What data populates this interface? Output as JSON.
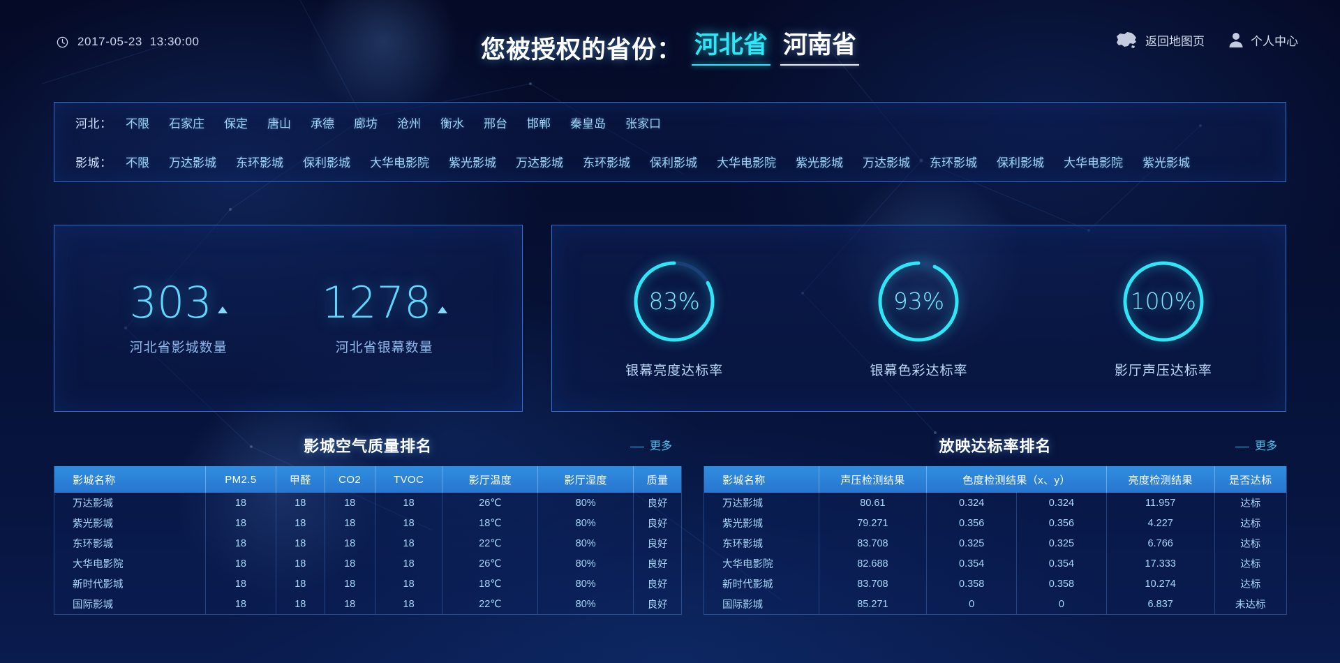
{
  "header": {
    "clock_icon": "clock-icon",
    "datetime": "2017-05-23  13:30:00",
    "title": "您被授权的省份：",
    "provinces": [
      {
        "label": "河北省",
        "active": true
      },
      {
        "label": "河南省",
        "active": false
      }
    ],
    "nav": [
      {
        "icon": "china-map-icon",
        "label": "返回地图页"
      },
      {
        "icon": "user-icon",
        "label": "个人中心"
      }
    ]
  },
  "filter": {
    "rows": [
      {
        "label": "河北：",
        "items": [
          "不限",
          "石家庄",
          "保定",
          "唐山",
          "承德",
          "廊坊",
          "沧州",
          "衡水",
          "邢台",
          "邯郸",
          "秦皇岛",
          "张家口"
        ]
      },
      {
        "label": "影城：",
        "items": [
          "不限",
          "万达影城",
          "东环影城",
          "保利影城",
          "大华电影院",
          "紫光影城",
          "万达影城",
          "东环影城",
          "保利影城",
          "大华电影院",
          "紫光影城",
          "万达影城",
          "东环影城",
          "保利影城",
          "大华电影院",
          "紫光影城"
        ]
      }
    ]
  },
  "stats": [
    {
      "value": "303",
      "label": "河北省影城数量",
      "trend": "up"
    },
    {
      "value": "1278",
      "label": "河北省银幕数量",
      "trend": "up"
    }
  ],
  "gauges": [
    {
      "value": "83%",
      "percent": 83,
      "label": "银幕亮度达标率"
    },
    {
      "value": "93%",
      "percent": 93,
      "label": "银幕色彩达标率"
    },
    {
      "value": "100%",
      "percent": 100,
      "label": "影厅声压达标率"
    }
  ],
  "colors": {
    "accent": "#2ee6f6",
    "header_blue": "#2f8ee0",
    "border": "#2f6fd0",
    "text_cyan": "#a8d8f8",
    "bg": "#061033"
  },
  "panels": {
    "air": {
      "title": "影城空气质量排名",
      "more": "更多",
      "columns": [
        "影城名称",
        "PM2.5",
        "甲醛",
        "CO2",
        "TVOC",
        "影厅温度",
        "影厅湿度",
        "质量"
      ],
      "rows": [
        [
          "万达影城",
          "18",
          "18",
          "18",
          "18",
          "26℃",
          "80%",
          "良好"
        ],
        [
          "紫光影城",
          "18",
          "18",
          "18",
          "18",
          "18℃",
          "80%",
          "良好"
        ],
        [
          "东环影城",
          "18",
          "18",
          "18",
          "18",
          "22℃",
          "80%",
          "良好"
        ],
        [
          "大华电影院",
          "18",
          "18",
          "18",
          "18",
          "26℃",
          "80%",
          "良好"
        ],
        [
          "新时代影城",
          "18",
          "18",
          "18",
          "18",
          "18℃",
          "80%",
          "良好"
        ],
        [
          "国际影城",
          "18",
          "18",
          "18",
          "18",
          "22℃",
          "80%",
          "良好"
        ]
      ]
    },
    "projection": {
      "title": "放映达标率排名",
      "more": "更多",
      "columns": [
        "影城名称",
        "声压检测结果",
        "色度检测结果（x、y）",
        "",
        "亮度检测结果",
        "是否达标"
      ],
      "header_display": [
        "影城名称",
        "声压检测结果",
        "色度检测结果（x、y）",
        "亮度检测结果",
        "是否达标"
      ],
      "rows": [
        [
          "万达影城",
          "80.61",
          "0.324",
          "0.324",
          "11.957",
          "达标"
        ],
        [
          "紫光影城",
          "79.271",
          "0.356",
          "0.356",
          "4.227",
          "达标"
        ],
        [
          "东环影城",
          "83.708",
          "0.325",
          "0.325",
          "6.766",
          "达标"
        ],
        [
          "大华电影院",
          "82.688",
          "0.354",
          "0.354",
          "17.333",
          "达标"
        ],
        [
          "新时代影城",
          "83.708",
          "0.358",
          "0.358",
          "10.274",
          "达标"
        ],
        [
          "国际影城",
          "85.271",
          "0",
          "0",
          "6.837",
          "未达标"
        ]
      ]
    }
  }
}
